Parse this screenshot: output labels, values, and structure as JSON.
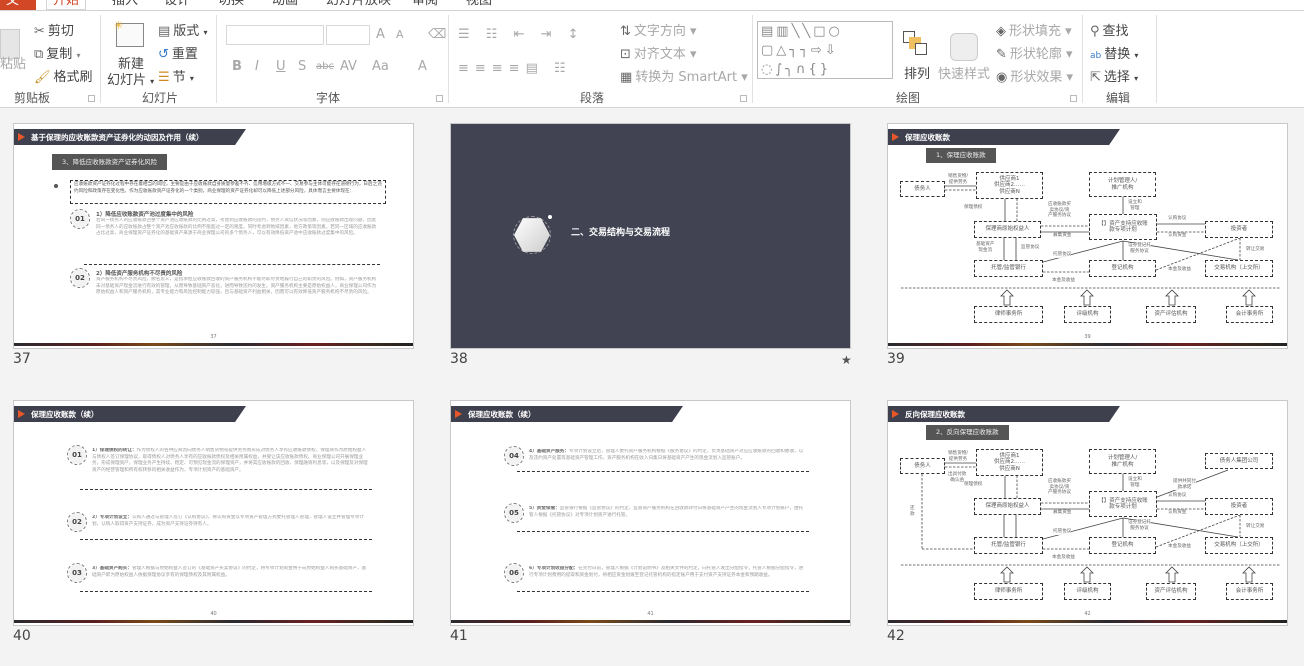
{
  "tabs": [
    "文件",
    "开始",
    "插入",
    "设计",
    "切换",
    "动画",
    "幻灯片放映",
    "审阅",
    "视图"
  ],
  "ribbon": {
    "clipboard": {
      "paste": "粘贴",
      "cut": "剪切",
      "copy": "复制",
      "format_painter": "格式刷",
      "group": "剪贴板"
    },
    "slides": {
      "new_slide_1": "新建",
      "new_slide_2": "幻灯片",
      "layout": "版式",
      "reset": "重置",
      "section": "节",
      "group": "幻灯片"
    },
    "font": {
      "bold": "B",
      "italic": "I",
      "underline": "U",
      "shadow": "S",
      "strike": "abc",
      "spacing": "AV",
      "case": "Aa",
      "color": "A",
      "grow": "A",
      "shrink": "A",
      "group": "字体"
    },
    "paragraph": {
      "text_direction": "文字方向",
      "align_text": "对齐文本",
      "smartart": "转换为 SmartArt",
      "group": "段落"
    },
    "drawing": {
      "arrange": "排列",
      "quick_styles": "快速样式",
      "fill": "形状填充",
      "outline": "形状轮廓",
      "effects": "形状效果",
      "group": "绘图"
    },
    "editing": {
      "find": "查找",
      "replace": "替换",
      "select": "选择",
      "group": "编辑"
    }
  },
  "slides": [
    {
      "number": "37",
      "title": "基于保理的应收账款资产证券化的动因及作用（续）",
      "subtitle": "3、降低应收账款资产证券化风险",
      "intro": "应收账款资产证券化过程中存在着相当的风险，主要是由于应收账款自身质量参差不齐、信用增级方式不一、交易参与主体可能存在道德行为，日后之违约风险和政策存在变化性。作为应收账款资产证券化的一个类别，商业保理的资产证券化却可以降低上述部分风险，具体而言主要体现在：",
      "items": [
        {
          "badge": "01",
          "title": "1）降低应收账款资产池过度集中的风险",
          "body": "若同一债务人的应收账款占整个资产池应收账款的比例过高，考虑到应收账款的违约，债务人资信状况等因素，则应收账款出现问题，因此同一债务人的应收账款占整个资产池应收账款的比例不能超过一定的限度。同时考虑到地域因素，地方政策等因素，若同一区域的应收账款占比过高，商业保理资产证券化的基础资产来源于商业保理公司的多个债务人，可以有效降低资产池中应收账款过度集中的风险。"
        },
        {
          "badge": "02",
          "title": "2）降低资产服务机构不尽责的风险",
          "body": "资产服务机构不尽责风险，顾名思义，是指承担应收账款回收的资产服务机构不能尽职尽责地履行自己的职责的风险。例如，资产服务机构未对基础资产现金流进行有效的管理，从而导致基础资产恶化，进而导致违约的发生。资产服务机构主要是原始权益人，商业保理公司作为原始权益人和资产服务机构，其专业能力和风险控制能力较强，且与基础资产利益相关，因而可以有效降低资产服务机构不尽责的风险。"
        }
      ],
      "page": "37"
    },
    {
      "number": "38",
      "title": "二、交易结构与交易流程",
      "starred": true
    },
    {
      "number": "39",
      "title": "保理应收账款",
      "subtitle": "1、保理应收账款",
      "boxes": {
        "debtor": "债务人",
        "suppliers": "供应商1\n供应商2……\n供应商N",
        "manager": "计划管理人/\n推广机构",
        "originator": "保理商原始权益人",
        "spv": "【】资产支持应收账\n款专项计划",
        "investor": "投资者",
        "bank": "托管/监管银行",
        "registry": "登记机构",
        "exchange": "交易机构（上交所）",
        "law": "律师事务所",
        "rating": "评级机构",
        "appraisal": "资产评估机构",
        "accounting": "会计事务所"
      },
      "edges": {
        "sale": "销售货物/\n提供劳务",
        "factoring": "保理债权",
        "purchase": "应收账款买\n卖协议/资\n产服务协议",
        "raise": "募集资金",
        "setup": "设立和\n管理",
        "subscribe": "认购协议",
        "subfund": "认购资金",
        "cashflow": "基础资产\n现金流",
        "supervise": "监管协议",
        "custody": "托管协议",
        "register": "证券登记托\n服务协议",
        "principal1": "本金及收益",
        "principal2": "本金及收益",
        "transfer": "转让交易"
      },
      "page": "39"
    },
    {
      "number": "40",
      "title": "保理应收账款（续）",
      "items": [
        {
          "badge": "01",
          "lead": "1）保理债权的转让：",
          "body": "作为债权人的各供应商因向债务人销售货物或提供劳务而形成对债务人享有应收账款债权，保理商作为原始权益人与债权人签订保理协议，取得债权人对债务人享有的应收账款债权及相关附属权益，并受让该应收账款债权。商业保理公司开展保理业务，形成保理资产，保理业务产生持续、稳定、可预见现金流的保理资产，并将其应收账款的回收、保理融资利息等，以及保理及对保理资产的经营管理和所有权转移的相关收益作为，专项计划资产的基础资产。"
        },
        {
          "badge": "02",
          "lead": "2）专项计划设立：",
          "body": "认购人通过与管理人签订《认购协议》，将认购资金以专项资产管理方式委托管理人管理，管理人设立并管理专项计划，认购人取得资产支持证券，成为资产支持证券持有人。"
        },
        {
          "badge": "03",
          "lead": "3）基础资产购买：",
          "body": "管理人根据与原始权益人签订的《基础资产买卖协议》的约定，将专项计划资金用于向原始权益人购买基础资产，基础资产即为原始权益人依据保理协议享有的保理债权及其附属权益。"
        }
      ],
      "page": "40"
    },
    {
      "number": "41",
      "title": "保理应收账款（续）",
      "items": [
        {
          "badge": "04",
          "lead": "4）基础资产服务：",
          "body": "专项计划设立后，管理人委托资产服务机构根据《服务协议》的约定，负责基础资产对应应收账款的回收和催收，以及违约资产处置等基础资产管理工作。资产服务机构在收入归集日将基础资产产生的现金流划入监管账户。"
        },
        {
          "badge": "05",
          "lead": "5）资金保管：",
          "body": "监管银行根据《监管协议》的约定，监管资产服务机构在回收款转付日将基础资产产生的现金流划入专项计划账户，由托管人根据《托管协议》对专项计划资产进行托管。"
        },
        {
          "badge": "06",
          "lead": "6）专项计划收益分配：",
          "body": "在兑付日前，管理人根据《计划说明书》及相关文件的约定，向托管人发出分配指令，托管人根据分配指令，进行专项计划费用的提取和资金划付，将相应资金划拨至登记托管机构的指定账户用于支付资产支持证券本金和预期收益。"
        }
      ],
      "page": "41"
    },
    {
      "number": "42",
      "title": "反向保理应收账款",
      "subtitle": "2、反向保理应收账款",
      "boxes": {
        "debtor": "债务人",
        "suppliers": "供应商1\n供应商2……\n供应商N",
        "manager": "计划管理人/\n推广机构",
        "group": "债务人集团公司",
        "originator": "保理商原始权益人",
        "spv": "【】资产支持应收账\n款专项计划",
        "investor": "投资者",
        "bank": "托管/监管银行",
        "registry": "登记机构",
        "exchange": "交易机构（上交所）",
        "law": "律师事务所",
        "rating": "评级机构",
        "appraisal": "资产评估机构",
        "accounting": "会计事务所"
      },
      "edges": {
        "sale": "销售货物/\n提供劳务",
        "confirm": "出具付款\n确认函",
        "factoring": "保理债权",
        "repay": "还\n款",
        "guarantee": "提供共同付\n款承诺",
        "purchase": "应收账款买\n卖协议/资\n产服务协议",
        "raise": "募集资金",
        "setup": "设立和\n管理",
        "subscribe": "认购协议",
        "subfund": "认购资金",
        "custody": "托管协议",
        "register": "证券登记托\n服务协议",
        "principal1": "本金及收益",
        "principal2": "本金及收益",
        "transfer": "转让交易"
      },
      "page": "42"
    }
  ]
}
